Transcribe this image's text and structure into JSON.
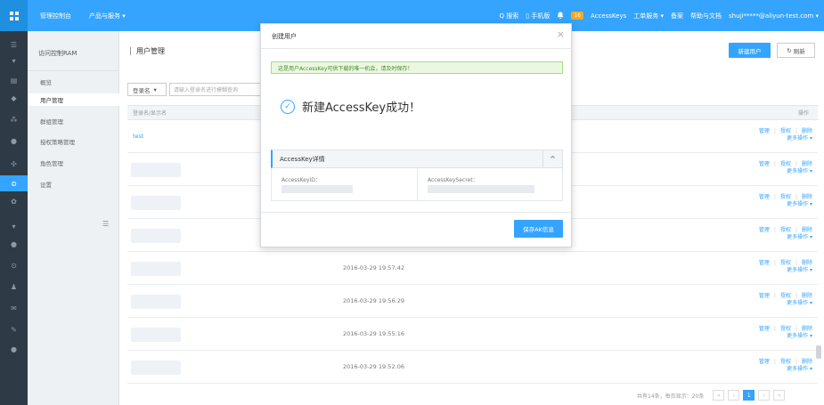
{
  "topbar": {
    "console": "管理控制台",
    "products": "产品与服务 ▾",
    "search": "Q 搜索",
    "mobile": "▯ 手机版",
    "bell": "🔔",
    "notif_count": "16",
    "accesskeys": "AccessKeys",
    "tickets": "工单服务 ▾",
    "record": "备案",
    "help": "帮助与文档",
    "account": "shuji*****@aliyun-test.com ▾"
  },
  "sidebar": {
    "title": "访问控制RAM",
    "items": [
      {
        "label": "概览"
      },
      {
        "label": "用户管理"
      },
      {
        "label": "群组管理"
      },
      {
        "label": "授权策略管理"
      },
      {
        "label": "角色管理"
      },
      {
        "label": "设置"
      }
    ]
  },
  "main": {
    "title": "用户管理",
    "new_user": "新建用户",
    "refresh": "刷新",
    "filter_select": "登录名",
    "search_placeholder": "请输入登录名进行模糊查询",
    "col_name": "登录名/显示名",
    "col_ops": "操作",
    "rows": [
      {
        "name": "test",
        "date": ""
      },
      {
        "name": "",
        "date": ""
      },
      {
        "name": "",
        "date": ""
      },
      {
        "name": "",
        "date": ""
      },
      {
        "name": "",
        "date": "2016-03-29 19:57:42"
      },
      {
        "name": "",
        "date": "2016-03-29 19:56:29"
      },
      {
        "name": "",
        "date": "2016-03-29 19:55:16"
      },
      {
        "name": "",
        "date": "2016-03-29 19:52:06"
      }
    ],
    "op_manage": "管理",
    "op_grant": "授权",
    "op_delete": "删除",
    "op_more": "更多操作 ▾",
    "pager_text": "共有14条，每页显示：20条",
    "pager_first": "«",
    "pager_prev": "‹",
    "pager_current": "1",
    "pager_next": "›",
    "pager_last": "»"
  },
  "modal": {
    "title": "创建用户",
    "close": "×",
    "notice": "这是用户AccessKey可供下载的唯一机会，请及时保存！",
    "success": "新建AccessKey成功！",
    "detail_title": "AccessKey详情",
    "detail_toggle": "^",
    "key_id_label": "AccessKeyID：",
    "key_secret_label": "AccessKeySecret：",
    "save_button": "保存AK信息"
  },
  "colors": {
    "accent": "#34a4ff",
    "nav_dark": "#2e3b47",
    "notice_bg": "#eaf8e1"
  }
}
